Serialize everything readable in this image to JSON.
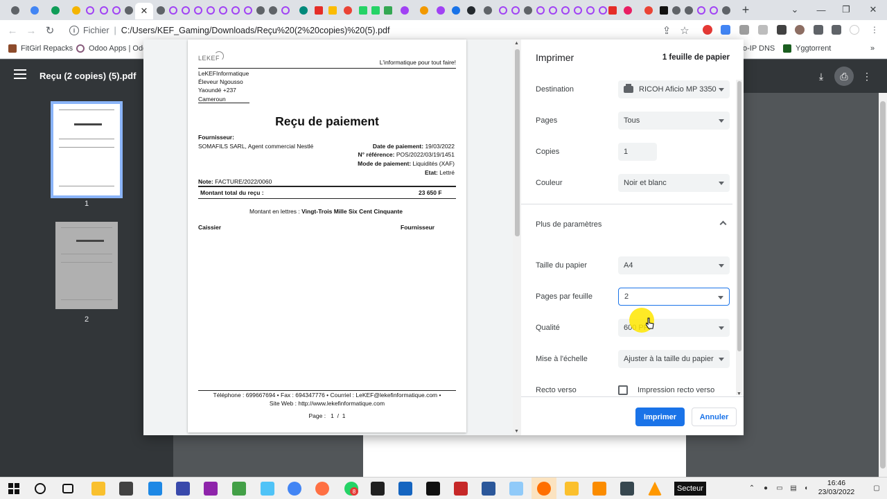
{
  "browser": {
    "active_tab_close": "✕",
    "new_tab": "+",
    "address": {
      "scheme_label": "Fichier",
      "separator": "|",
      "url": "C:/Users/KEF_Gaming/Downloads/Reçu%20(2%20copies)%20(5).pdf"
    },
    "bookmarks": [
      {
        "label": "FitGirl Repacks"
      },
      {
        "label": "Odoo Apps | Odo"
      },
      {
        "label": "o-IP DNS"
      },
      {
        "label": "Yggtorrent"
      }
    ],
    "bookmarks_more": "»"
  },
  "pdf_viewer": {
    "title": "Reçu (2 copies) (5).pdf",
    "thumbnails": [
      {
        "number": "1"
      },
      {
        "number": "2"
      }
    ]
  },
  "print_dialog": {
    "title": "Imprimer",
    "sheet_count": "1 feuille de papier",
    "rows": {
      "destination": {
        "label": "Destination",
        "value": "RICOH Aficio MP 3350"
      },
      "pages": {
        "label": "Pages",
        "value": "Tous"
      },
      "copies": {
        "label": "Copies",
        "value": "1"
      },
      "color": {
        "label": "Couleur",
        "value": "Noir et blanc"
      },
      "more": {
        "label": "Plus de paramètres"
      },
      "paper_size": {
        "label": "Taille du papier",
        "value": "A4"
      },
      "pages_per_sheet": {
        "label": "Pages par feuille",
        "value": "2"
      },
      "quality": {
        "label": "Qualité",
        "value": "600 PPP"
      },
      "scale": {
        "label": "Mise à l'échelle",
        "value": "Ajuster à la taille du papier"
      },
      "duplex": {
        "label": "Recto verso",
        "value": "Impression recto verso"
      }
    },
    "print_button": "Imprimer",
    "cancel_button": "Annuler"
  },
  "receipt": {
    "logo": "LEKEF",
    "slogan": "L'informatique pour tout faire!",
    "company_lines": [
      "LeKEFInformatique",
      "Éleveur Ngousso",
      "Yaoundé +237",
      "Cameroun"
    ],
    "title": "Reçu de paiement",
    "supplier_label": "Fournisseur:",
    "supplier_name": "SOMAFILS SARL, Agent commercial Nestlé",
    "date_label": "Date de paiement:",
    "date_value": "19/03/2022",
    "ref_label": "N° référence:",
    "ref_value": "POS/2022/03/19/1451",
    "mode_label": "Mode de paiement:",
    "mode_value": "Liquidités (XAF)",
    "state_label": "Etat:",
    "state_value": "Lettré",
    "note_label": "Note:",
    "note_value": "FACTURE/2022/0060",
    "total_label": "Montant total du reçu :",
    "total_value": "23 650 F",
    "words_label": "Montant en lettres :",
    "words_value": "Vingt-Trois Mille Six Cent Cinquante",
    "cashier": "Caissier",
    "supplier_sign": "Fournisseur",
    "footer_line1": "Téléphone : 699667694  •  Fax : 694347776  •  Courriel : LeKEF@lekefinformatique.com  •",
    "footer_line2": "Site Web : http://www.lekefinformatique.com",
    "page_label": "Page :",
    "page_current": "1",
    "page_sep": "/",
    "page_total": "1"
  },
  "taskbar": {
    "secteur": "Secteur",
    "badge": "8",
    "time": "16:46",
    "date": "23/03/2022"
  },
  "colors": {
    "accent": "#1a73e8",
    "chrome_bg": "#dee1e6",
    "pdf_toolbar": "#323639",
    "cursor_highlight": "#ffe600"
  }
}
